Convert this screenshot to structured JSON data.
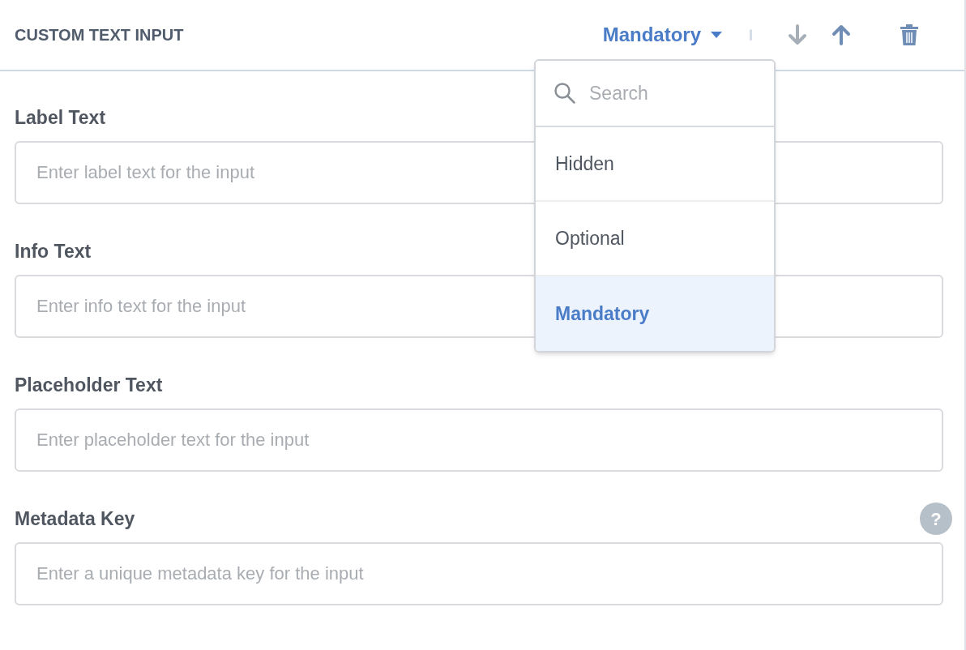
{
  "header": {
    "title": "CUSTOM TEXT INPUT",
    "requirement": {
      "value": "Mandatory",
      "expanded": true
    },
    "move_down": {
      "disabled": true
    },
    "move_up": {
      "disabled": false
    }
  },
  "fields": [
    {
      "label": "Label Text",
      "placeholder": "Enter label text for the input"
    },
    {
      "label": "Info Text",
      "placeholder": "Enter info text for the input"
    },
    {
      "label": "Placeholder Text",
      "placeholder": "Enter placeholder text for the input"
    },
    {
      "label": "Metadata Key",
      "placeholder": "Enter a unique metadata key for the input",
      "help": "?"
    }
  ],
  "dropdown": {
    "search": {
      "placeholder": "Search"
    },
    "options": [
      {
        "label": "Hidden",
        "selected": false
      },
      {
        "label": "Optional",
        "selected": false
      },
      {
        "label": "Mandatory",
        "selected": true
      }
    ]
  }
}
